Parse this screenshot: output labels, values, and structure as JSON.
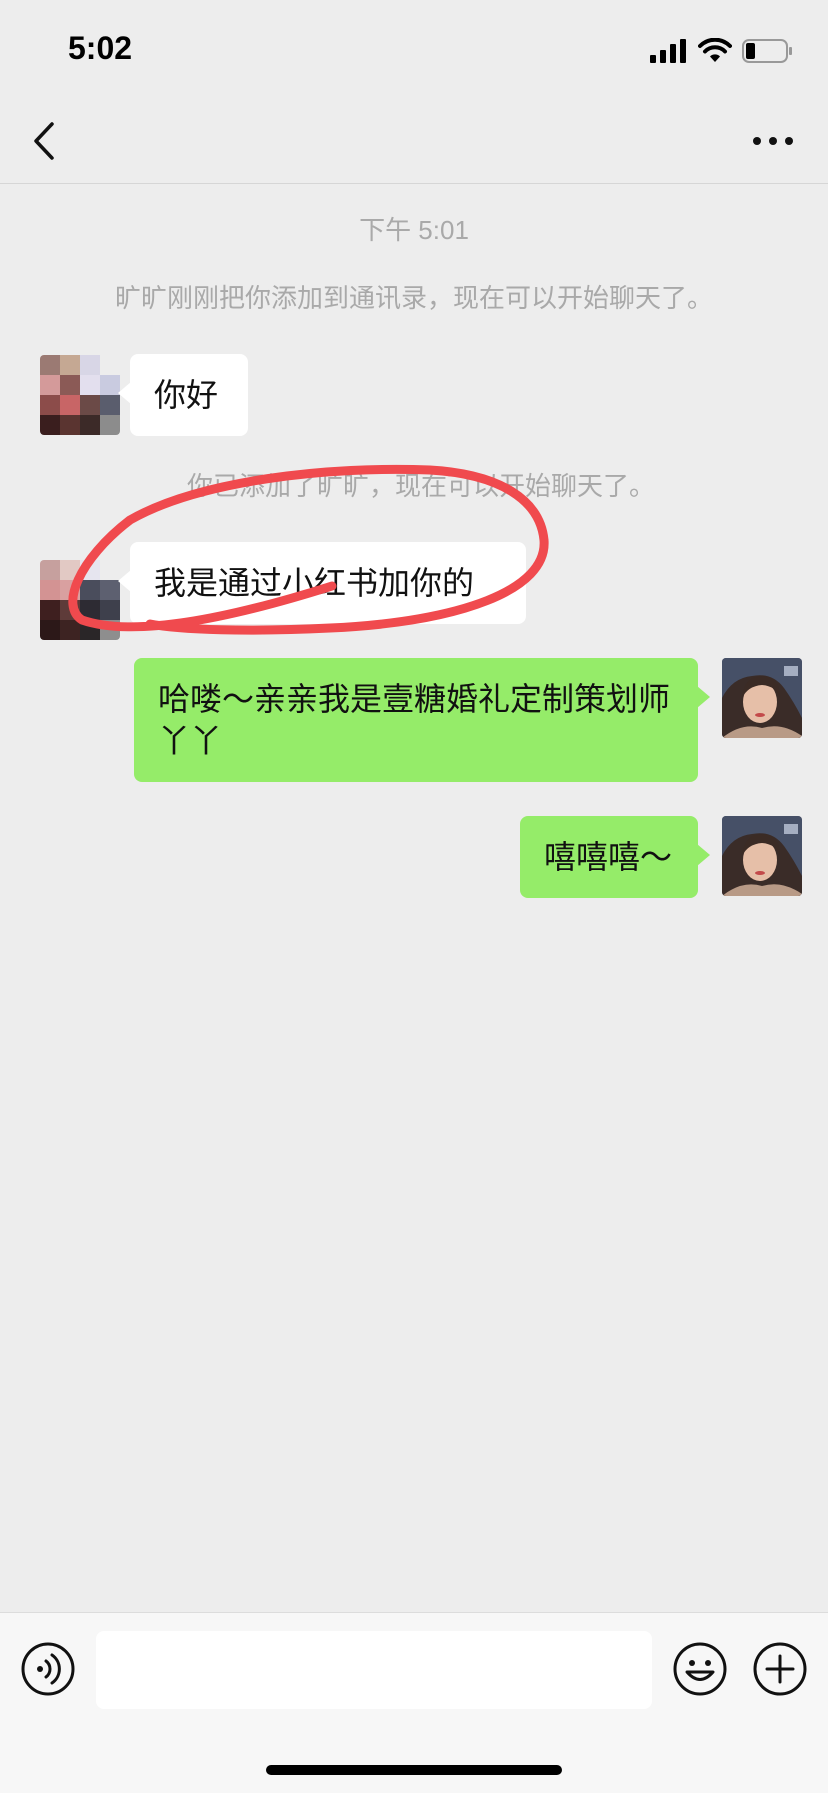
{
  "status_bar": {
    "time": "5:02"
  },
  "nav": {
    "back_icon": "chevron-left-icon",
    "more_icon": "ellipsis-icon"
  },
  "chat": {
    "timestamp": "下午 5:01",
    "system_message_1": "旷旷刚刚把你添加到通讯录，现在可以开始聊天了。",
    "system_message_2": "你已添加了旷旷，现在可以开始聊天了。",
    "messages": [
      {
        "from": "contact",
        "text": "你好"
      },
      {
        "from": "contact",
        "text": "我是通过小红书加你的",
        "highlighted": true
      },
      {
        "from": "me",
        "text": "哈喽～亲亲我是壹糖婚礼定制策划师丫丫"
      },
      {
        "from": "me",
        "text": "嘻嘻嘻～"
      }
    ]
  },
  "colors": {
    "background": "#ededed",
    "incoming_bubble": "#ffffff",
    "outgoing_bubble": "#95ec69",
    "annotation": "#f04a4e"
  },
  "input_bar": {
    "voice_icon": "voice-icon",
    "emoji_icon": "emoji-icon",
    "plus_icon": "plus-circle-icon",
    "input_value": "",
    "placeholder": ""
  }
}
